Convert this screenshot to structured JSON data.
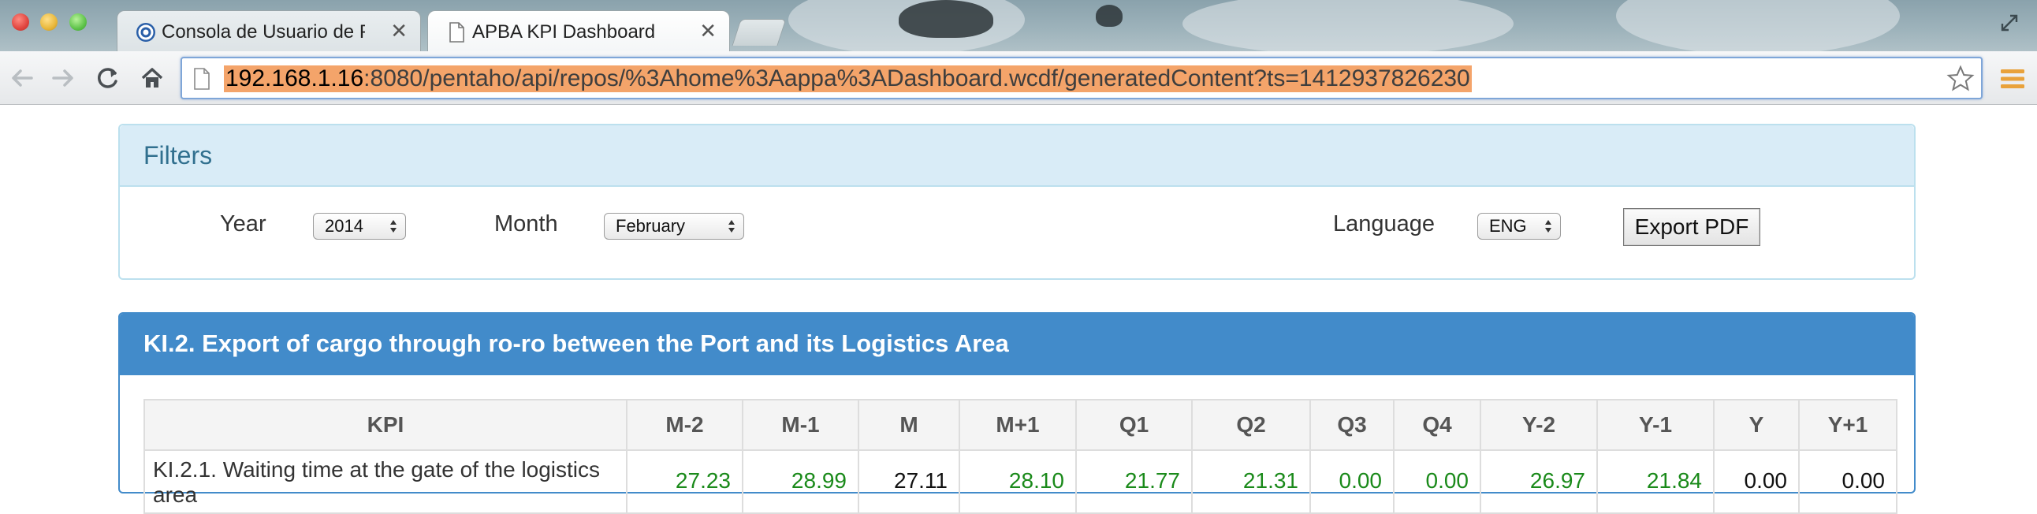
{
  "browser": {
    "tabs": [
      {
        "title": "Consola de Usuario de Pentaho",
        "active": false,
        "icon": "pentaho-swirl-icon"
      },
      {
        "title": "APBA KPI Dashboard",
        "active": true,
        "icon": "document-icon"
      }
    ],
    "url_host": "192.168.1.16",
    "url_rest": ":8080/pentaho/api/repos/%3Ahome%3Aappa%3ADashboard.wcdf/generatedContent?ts=1412937826230",
    "url_highlight_color": "#f4a46a"
  },
  "filters": {
    "title": "Filters",
    "year_label": "Year",
    "year_value": "2014",
    "month_label": "Month",
    "month_value": "February",
    "language_label": "Language",
    "language_value": "ENG",
    "export_label": "Export PDF"
  },
  "kpi_panel": {
    "title": "KI.2. Export of cargo through ro-ro between the Port and its Logistics Area",
    "accent": "#428bca",
    "columns": [
      "KPI",
      "M-2",
      "M-1",
      "M",
      "M+1",
      "Q1",
      "Q2",
      "Q3",
      "Q4",
      "Y-2",
      "Y-1",
      "Y",
      "Y+1"
    ],
    "rows": [
      {
        "kpi": "KI.2.1. Waiting time at the gate of the logistics area",
        "cells": [
          {
            "value": "27.23",
            "color": "green"
          },
          {
            "value": "28.99",
            "color": "green"
          },
          {
            "value": "27.11",
            "color": "black"
          },
          {
            "value": "28.10",
            "color": "green"
          },
          {
            "value": "21.77",
            "color": "green"
          },
          {
            "value": "21.31",
            "color": "green"
          },
          {
            "value": "0.00",
            "color": "green"
          },
          {
            "value": "0.00",
            "color": "green"
          },
          {
            "value": "26.97",
            "color": "green"
          },
          {
            "value": "21.84",
            "color": "green"
          },
          {
            "value": "0.00",
            "color": "black"
          },
          {
            "value": "0.00",
            "color": "black"
          }
        ]
      }
    ]
  }
}
